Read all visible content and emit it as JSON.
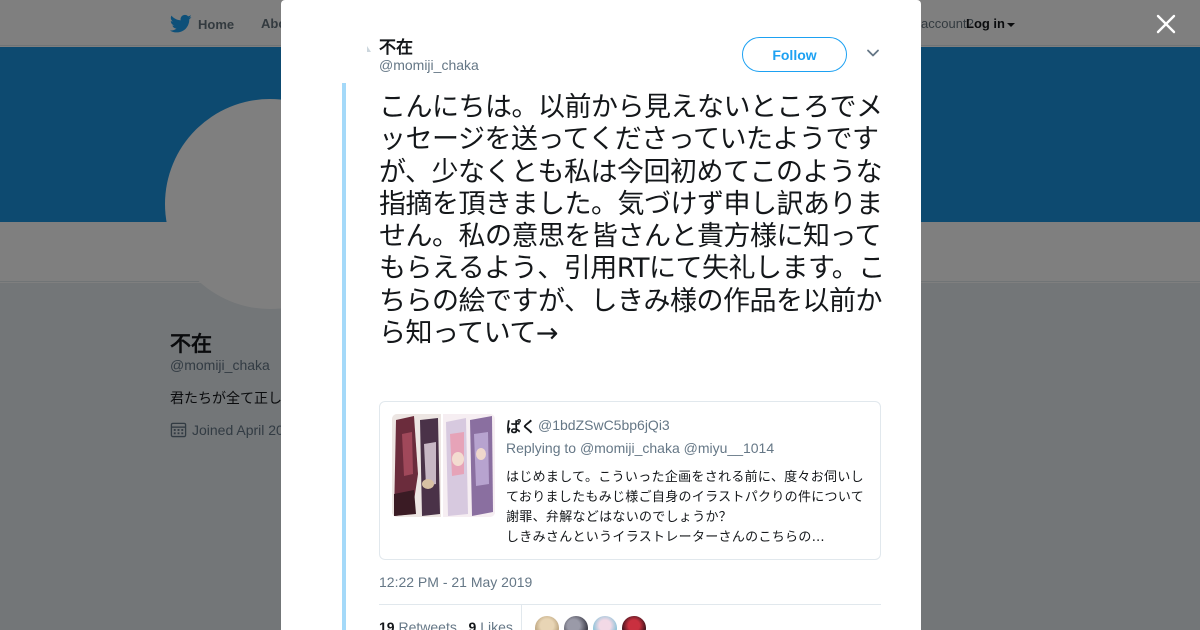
{
  "topbar": {
    "home_label": "Home",
    "about_label": "Abo",
    "account_prompt": "account?",
    "login_label": "Log in"
  },
  "profile": {
    "name": "不在",
    "handle": "@momiji_chaka",
    "bio": "君たちが全て正し",
    "joined": "Joined April 20"
  },
  "tweet": {
    "author_name": "不在",
    "author_handle": "@momiji_chaka",
    "follow_label": "Follow",
    "text": "こんにちは。以前から見えないところでメッセージを送ってくださっていたようですが、少なくとも私は今回初めてこのような指摘を頂きました。気づけず申し訳ありません。私の意思を皆さんと貴方様に知ってもらえるよう、引用RTにて失礼します。こちらの絵ですが、しきみ様の作品を以前から知っていて→",
    "timestamp": "12:22 PM - 21 May 2019",
    "retweets_count": "19",
    "retweets_label": "Retweets",
    "likes_count": "9",
    "likes_label": "Likes"
  },
  "quote": {
    "name": "ぱく",
    "handle": "@1bdZSwC5bp6jQi3",
    "replying_prefix": "Replying to",
    "reply_to_1": "@momiji_chaka",
    "reply_to_2": "@miyu__1014",
    "text": "はじめまして。こういった企画をされる前に、度々お伺いしておりましたもみじ様ご自身のイラストパクりの件について謝罪、弁解などはないのでしょうか？\nしきみさんというイラストレーターさんのこちらの…"
  },
  "colors": {
    "twitter_blue": "#1da1f2",
    "banner": "#1b95e0",
    "thread_line": "#a4d9f9",
    "secondary_text": "#657786"
  },
  "icons": [
    "twitter-bird-icon",
    "calendar-icon",
    "close-icon",
    "chevron-down-icon"
  ]
}
